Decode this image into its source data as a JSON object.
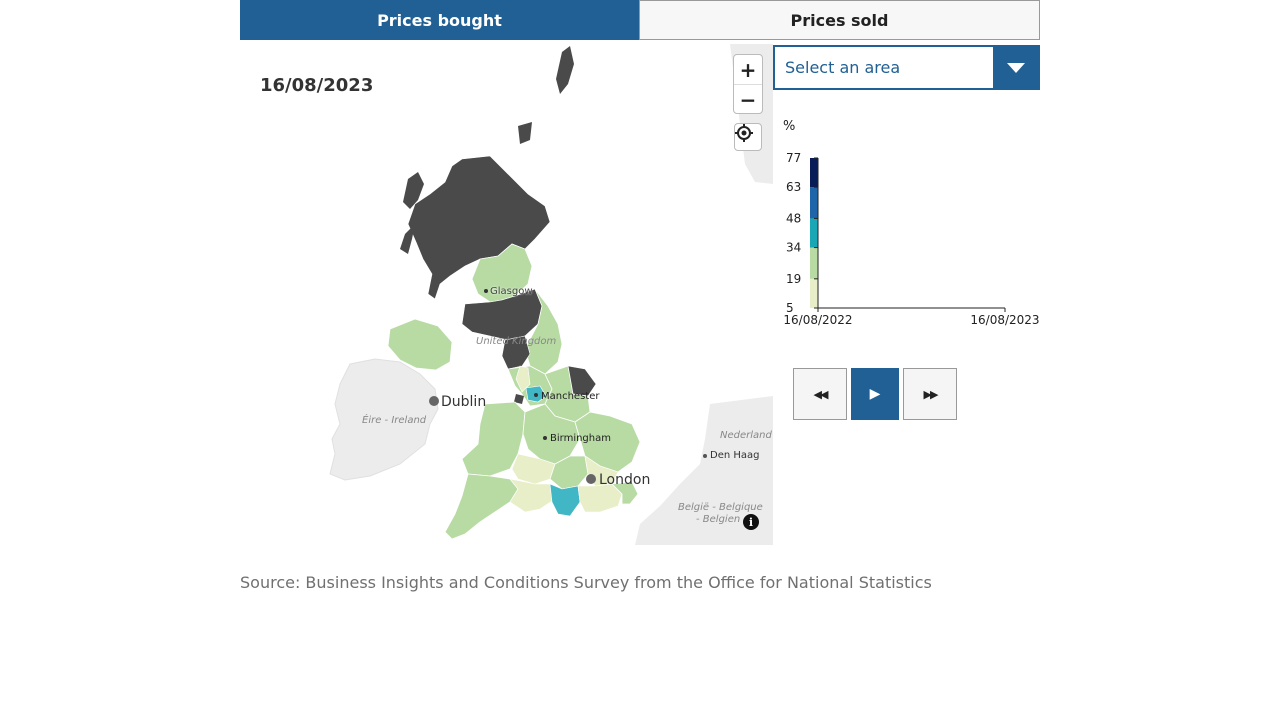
{
  "tabs": [
    {
      "label": "Prices bought",
      "active": true
    },
    {
      "label": "Prices sold",
      "active": false
    }
  ],
  "map": {
    "date": "16/08/2023",
    "places": {
      "glasgow": "Glasgow",
      "united_kingdom": "United Kingdom",
      "manchester": "Manchester",
      "birmingham": "Birmingham",
      "london": "London",
      "dublin": "Dublin",
      "ireland": "Éire - Ireland",
      "nederland": "Nederland",
      "den_haag": "Den Haag",
      "belgie1": "België - Belgique",
      "belgie2": "- Belgien"
    },
    "colors": {
      "no_data": "#4a4a4a",
      "band1": "#e8eec8",
      "band2": "#b8dba4",
      "band3": "#41b6c4",
      "band4": "#1d64a8",
      "band5": "#081d58",
      "land": "#ececec"
    },
    "controls": {
      "zoom_in": "+",
      "zoom_out": "−",
      "locate_icon": "crosshair-icon",
      "info": "i"
    }
  },
  "area_select": {
    "placeholder": "Select an area"
  },
  "chart_data": {
    "type": "legend-timeline",
    "unit_label": "%",
    "y_ticks": [
      "77",
      "63",
      "48",
      "34",
      "19",
      "5"
    ],
    "x_labels": [
      "16/08/2022",
      "16/08/2023"
    ],
    "bands": [
      {
        "from": 5,
        "to": 19,
        "color": "#e8eec8"
      },
      {
        "from": 19,
        "to": 34,
        "color": "#b8dba4"
      },
      {
        "from": 34,
        "to": 48,
        "color": "#1aa7b5"
      },
      {
        "from": 48,
        "to": 63,
        "color": "#1d64a8"
      },
      {
        "from": 63,
        "to": 77,
        "color": "#081d58"
      }
    ],
    "ylim": [
      5,
      77
    ]
  },
  "playback": {
    "rewind": "◀◀",
    "play": "▶",
    "forward": "▶▶"
  },
  "source": "Source: Business Insights and Conditions Survey from the Office for National Statistics"
}
